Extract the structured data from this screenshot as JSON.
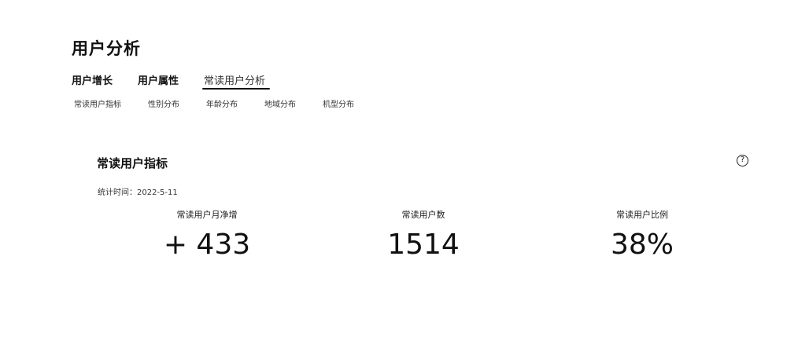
{
  "page": {
    "title": "用户分析"
  },
  "main_tabs": [
    {
      "label": "用户增长"
    },
    {
      "label": "用户属性"
    },
    {
      "label": "常读用户分析"
    }
  ],
  "sub_tabs": [
    {
      "label": "常读用户指标"
    },
    {
      "label": "性别分布"
    },
    {
      "label": "年龄分布"
    },
    {
      "label": "地域分布"
    },
    {
      "label": "机型分布"
    }
  ],
  "card": {
    "title": "常读用户指标",
    "help_icon": "question-circle-icon",
    "date_text": "统计时间：2022-5-11"
  },
  "metrics": [
    {
      "label": "常读用户月净增",
      "value": "+ 433"
    },
    {
      "label": "常读用户数",
      "value": "1514"
    },
    {
      "label": "常读用户比例",
      "value": "38%"
    }
  ]
}
